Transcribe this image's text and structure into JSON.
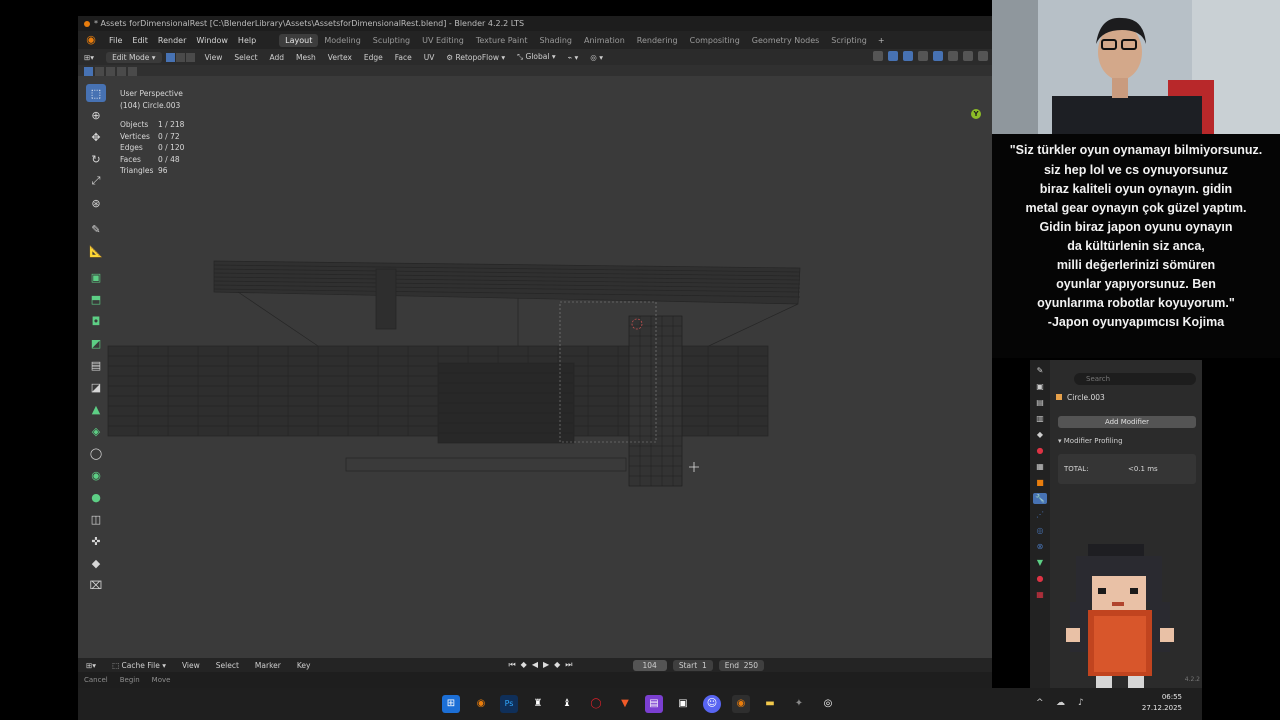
{
  "window": {
    "title": "* Assets forDimensionalRest [C:\\BlenderLibrary\\Assets\\AssetsforDimensionalRest.blend] - Blender 4.2.2 LTS"
  },
  "menu": [
    "File",
    "Edit",
    "Render",
    "Window",
    "Help"
  ],
  "workspaces": [
    "Layout",
    "Modeling",
    "Sculpting",
    "UV Editing",
    "Texture Paint",
    "Shading",
    "Animation",
    "Rendering",
    "Compositing",
    "Geometry Nodes",
    "Scripting"
  ],
  "active_workspace": "Layout",
  "header": {
    "mode": "Edit Mode",
    "items": [
      "View",
      "Select",
      "Add",
      "Mesh",
      "Vertex",
      "Edge",
      "Face",
      "UV"
    ],
    "addon": "RetopoFlow",
    "orientation": "Global"
  },
  "viewport": {
    "view_name": "User Perspective",
    "object_name": "(104) Circle.003",
    "stats": [
      {
        "label": "Objects",
        "value": "1 / 218"
      },
      {
        "label": "Vertices",
        "value": "0 / 72"
      },
      {
        "label": "Edges",
        "value": "0 / 120"
      },
      {
        "label": "Faces",
        "value": "0 / 48"
      },
      {
        "label": "Triangles",
        "value": "96"
      }
    ],
    "gizmo_axis": "Y"
  },
  "timeline": {
    "editor": "Cache File",
    "items": [
      "View",
      "Select",
      "Marker",
      "Key"
    ],
    "current_frame": "104",
    "start_label": "Start",
    "start_value": "1",
    "end_label": "End",
    "end_value": "250"
  },
  "statusbar": [
    "Cancel",
    "Begin",
    "Move"
  ],
  "properties": {
    "search_placeholder": "Search",
    "object": "Circle.003",
    "add_modifier": "Add Modifier",
    "profiling_header": "Modifier Profiling",
    "total_label": "TOTAL:",
    "total_value": "<0.1 ms"
  },
  "caption": {
    "lines": [
      "\"Siz türkler oyun oynamayı bilmiyorsunuz.",
      "siz hep lol ve cs oynuyorsunuz",
      "biraz kaliteli oyun oynayın. gidin",
      "metal gear oynayın çok güzel yaptım.",
      "Gidin biraz japon oyunu oynayın",
      "da kültürlenin siz anca,",
      "milli değerlerinizi sömüren",
      "oyunlar yapıyorsunuz. Ben",
      "oyunlarıma robotlar koyuyorum.\"",
      "-Japon oyunyapımcısı Kojima"
    ]
  },
  "taskbar": {
    "time": "06:55",
    "date": "27.12.2025",
    "version": "4.2.2"
  },
  "colors": {
    "blender_orange": "#e87d0d",
    "active_blue": "#4772b3",
    "gizmo_green": "#8cbd27"
  }
}
